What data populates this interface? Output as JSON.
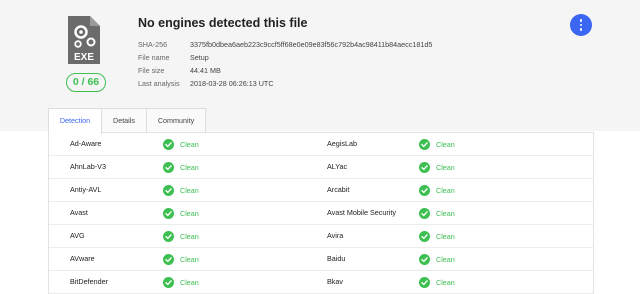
{
  "header": {
    "title": "No engines detected this file",
    "score": "0 / 66",
    "file_type_label": "EXE",
    "meta": [
      {
        "key": "SHA-256",
        "value": "3375fb0dbea6aeb223c9ccf5ff68e0e09e83f56c792b4ac98411b84aecc181d5"
      },
      {
        "key": "File name",
        "value": "Setup"
      },
      {
        "key": "File size",
        "value": "44.41 MB"
      },
      {
        "key": "Last analysis",
        "value": "2018-03-28 06:26:13 UTC"
      }
    ]
  },
  "tabs": [
    "Detection",
    "Details",
    "Community"
  ],
  "results": [
    {
      "left": {
        "engine": "Ad-Aware",
        "status": "Clean"
      },
      "right": {
        "engine": "AegisLab",
        "status": "Clean"
      }
    },
    {
      "left": {
        "engine": "AhnLab-V3",
        "status": "Clean"
      },
      "right": {
        "engine": "ALYac",
        "status": "Clean"
      }
    },
    {
      "left": {
        "engine": "Antiy-AVL",
        "status": "Clean"
      },
      "right": {
        "engine": "Arcabit",
        "status": "Clean"
      }
    },
    {
      "left": {
        "engine": "Avast",
        "status": "Clean"
      },
      "right": {
        "engine": "Avast Mobile Security",
        "status": "Clean"
      }
    },
    {
      "left": {
        "engine": "AVG",
        "status": "Clean"
      },
      "right": {
        "engine": "Avira",
        "status": "Clean"
      }
    },
    {
      "left": {
        "engine": "AVware",
        "status": "Clean"
      },
      "right": {
        "engine": "Baidu",
        "status": "Clean"
      }
    },
    {
      "left": {
        "engine": "BitDefender",
        "status": "Clean"
      },
      "right": {
        "engine": "Bkav",
        "status": "Clean"
      }
    }
  ],
  "colors": {
    "clean": "#3dbf52",
    "accent": "#3b66f2"
  },
  "icons": {
    "file": "exe-file-gear-icon",
    "status": "check-circle-icon",
    "menu": "more-vertical-icon"
  }
}
